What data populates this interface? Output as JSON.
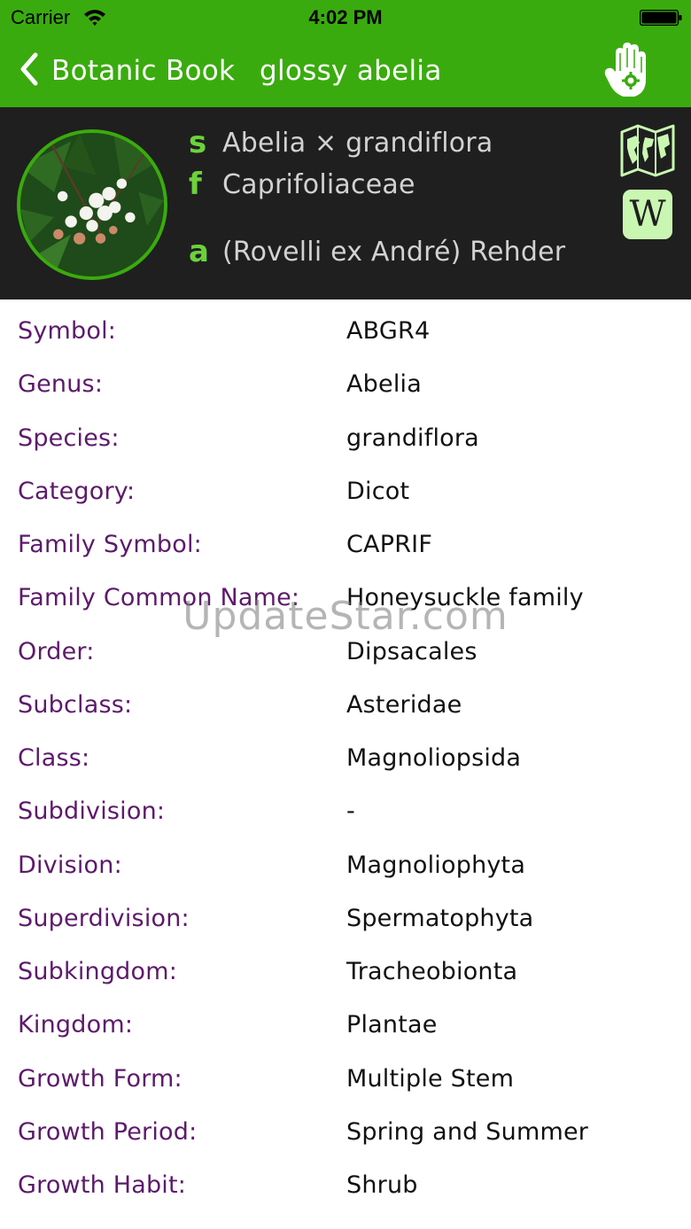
{
  "status_bar": {
    "carrier": "Carrier",
    "time": "4:02 PM"
  },
  "nav": {
    "back_label": "Botanic Book",
    "title": "glossy abelia"
  },
  "plant": {
    "scientific_name": "Abelia × grandiflora",
    "family": "Caprifoliaceae",
    "author": "(Rovelli ex André) Rehder",
    "letters": {
      "s": "s",
      "f": "f",
      "a": "a"
    }
  },
  "header_buttons": {
    "wiki_label": "W"
  },
  "details": [
    {
      "label": "Symbol:",
      "value": "ABGR4"
    },
    {
      "label": "Genus:",
      "value": "Abelia"
    },
    {
      "label": "Species:",
      "value": "grandiflora"
    },
    {
      "label": "Category:",
      "value": "Dicot"
    },
    {
      "label": "Family Symbol:",
      "value": "CAPRIF"
    },
    {
      "label": "Family Common Name:",
      "value": "Honeysuckle family"
    },
    {
      "label": "Order:",
      "value": "Dipsacales"
    },
    {
      "label": "Subclass:",
      "value": "Asteridae"
    },
    {
      "label": "Class:",
      "value": "Magnoliopsida"
    },
    {
      "label": "Subdivision:",
      "value": "-"
    },
    {
      "label": "Division:",
      "value": "Magnoliophyta"
    },
    {
      "label": "Superdivision:",
      "value": "Spermatophyta"
    },
    {
      "label": "Subkingdom:",
      "value": "Tracheobionta"
    },
    {
      "label": "Kingdom:",
      "value": "Plantae"
    },
    {
      "label": "Growth Form:",
      "value": "Multiple Stem"
    },
    {
      "label": "Growth Period:",
      "value": "Spring and Summer"
    },
    {
      "label": "Growth Habit:",
      "value": "Shrub"
    }
  ],
  "watermark": "UpdateStar.com",
  "colors": {
    "brand_green": "#3aab0e",
    "header_dark": "#1f1f1f",
    "label_purple": "#5d1a6b",
    "letter_green": "#6cd23c",
    "wiki_bg": "#c9f7b2"
  },
  "icons": {
    "back": "chevron-left-icon",
    "hand": "hand-icon",
    "map": "world-map-icon",
    "wiki": "wikipedia-icon",
    "wifi": "wifi-icon",
    "battery": "battery-icon"
  }
}
